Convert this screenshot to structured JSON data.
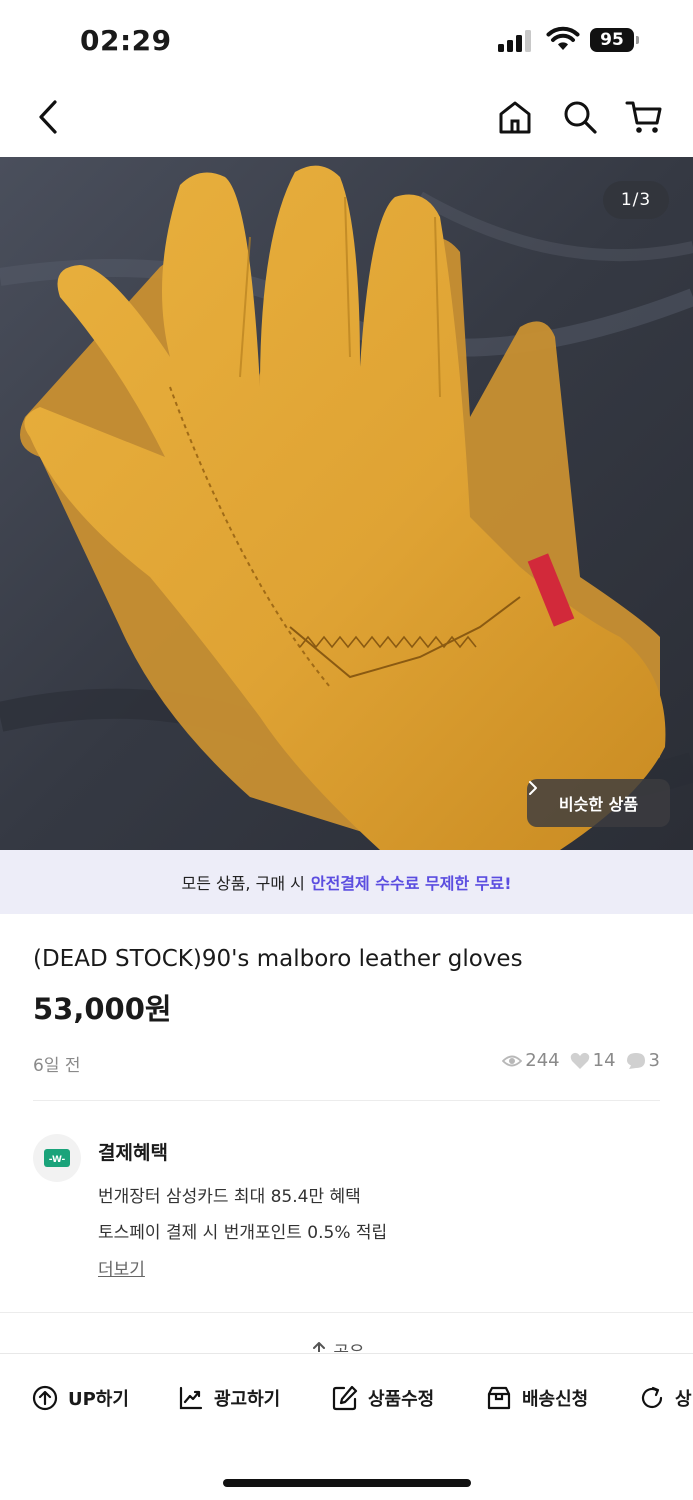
{
  "status_bar": {
    "time": "02:29",
    "battery": "95"
  },
  "nav": {
    "icons": [
      "back-arrow-icon",
      "home-icon",
      "search-icon",
      "cart-icon"
    ]
  },
  "product_image": {
    "page_indicator": "1/3",
    "similar_label": "비슷한 상품"
  },
  "promo": {
    "prefix": "모든 상품, 구매 시",
    "highlight": "안전결제 수수료 무제한 무료!",
    "highlight_color": "#5b4de0"
  },
  "product": {
    "title": "(DEAD STOCK)90's malboro leather gloves",
    "price": "53,000원",
    "posted": "6일 전",
    "views": "244",
    "likes": "14",
    "chats": "3"
  },
  "benefits": {
    "title": "결제혜택",
    "lines": [
      "번개장터 삼성카드 최대 85.4만 혜택",
      "토스페이 결제 시 번개포인트 0.5% 적립"
    ],
    "more": "더보기",
    "icon_color": "#1aa37a"
  },
  "share": {
    "label": "공유"
  },
  "actions": [
    {
      "label": "UP하기",
      "icon": "up-arrow-circle-icon"
    },
    {
      "label": "광고하기",
      "icon": "trend-chart-icon"
    },
    {
      "label": "상품수정",
      "icon": "edit-icon"
    },
    {
      "label": "배송신청",
      "icon": "box-icon"
    },
    {
      "label": "상",
      "icon": "refresh-icon"
    }
  ]
}
